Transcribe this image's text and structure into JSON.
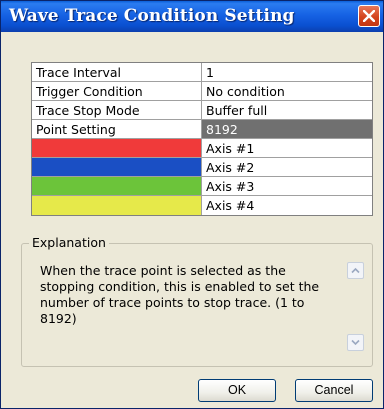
{
  "window": {
    "title": "Wave Trace Condition Setting"
  },
  "settings": [
    {
      "label": "Trace Interval",
      "value": "1"
    },
    {
      "label": "Trigger Condition",
      "value": "No condition"
    },
    {
      "label": "Trace Stop Mode",
      "value": "Buffer full"
    },
    {
      "label": "Point Setting",
      "value": "8192"
    }
  ],
  "axes": [
    {
      "color": "#f03a3a",
      "label": "Axis #1"
    },
    {
      "color": "#1a4fc4",
      "label": "Axis #2"
    },
    {
      "color": "#6cc43a",
      "label": "Axis #3"
    },
    {
      "color": "#e6e94a",
      "label": "Axis #4"
    }
  ],
  "explanation": {
    "caption": "Explanation",
    "text": "When the trace point is selected as the stopping condition, this is enabled to set the number of trace points to stop trace. (1 to 8192)"
  },
  "buttons": {
    "ok": "OK",
    "cancel": "Cancel"
  },
  "icons": {
    "close": "close-icon",
    "scroll_up": "chevron-up-icon",
    "scroll_down": "chevron-down-icon"
  }
}
